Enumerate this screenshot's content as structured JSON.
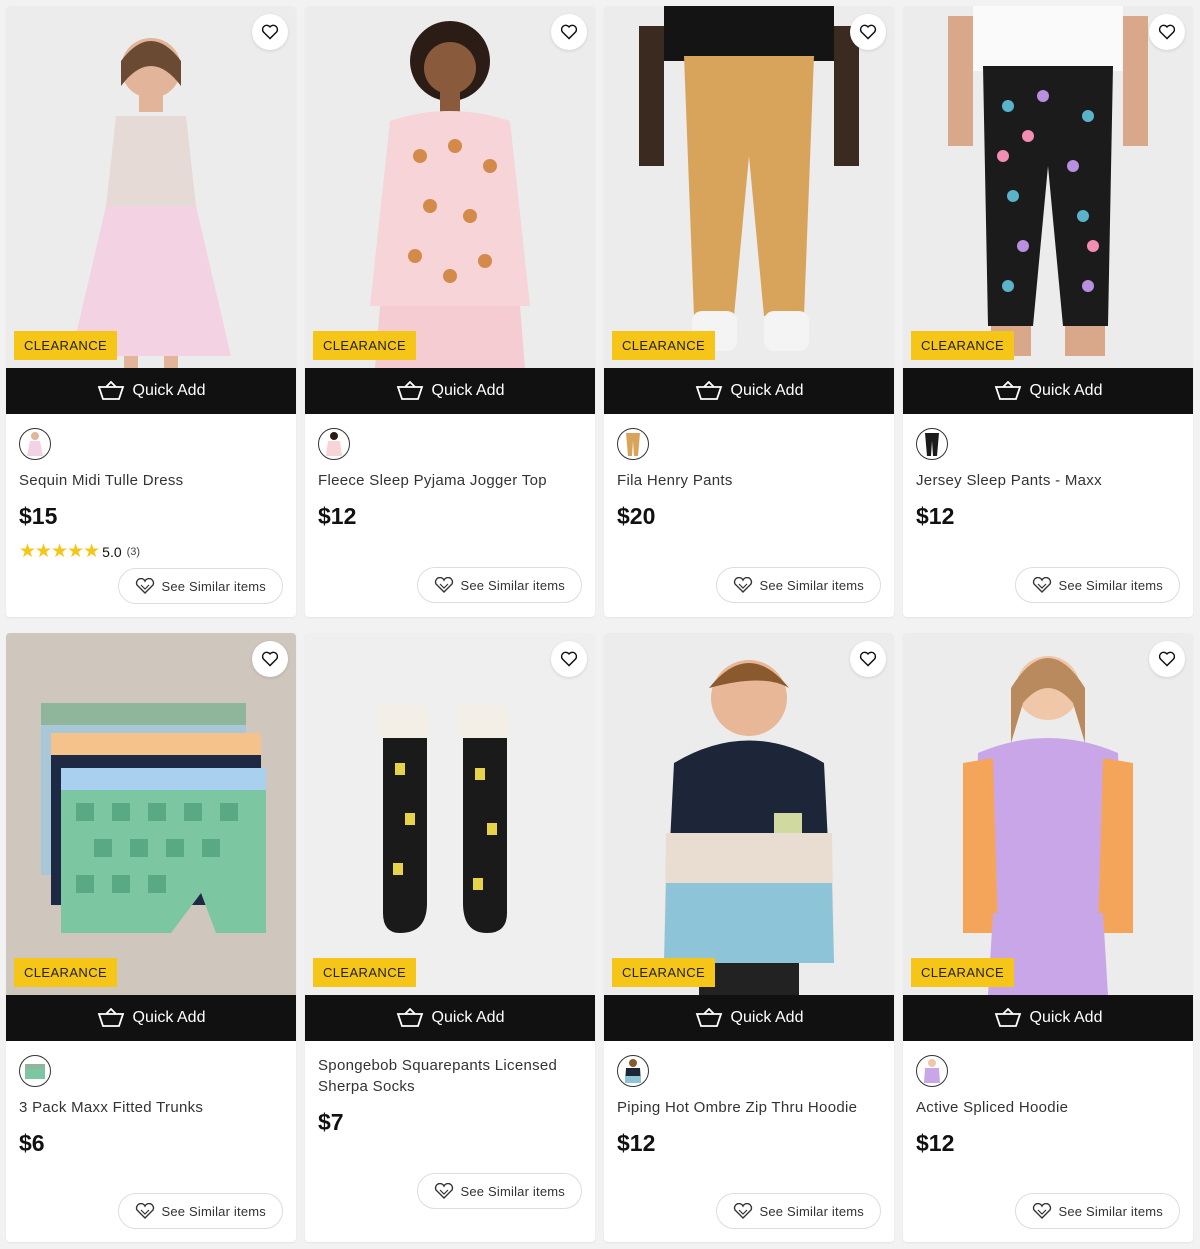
{
  "quick_add_label": "Quick Add",
  "badge_label": "CLEARANCE",
  "see_similar_label": "See Similar items",
  "products": [
    {
      "title": "Sequin Midi Tulle Dress",
      "price": "$15",
      "rating": "5.0",
      "rating_count": "(3)",
      "stars": "★★★★★",
      "badge": "CLEARANCE"
    },
    {
      "title": "Fleece Sleep Pyjama Jogger Top",
      "price": "$12",
      "badge": "CLEARANCE"
    },
    {
      "title": "Fila Henry Pants",
      "price": "$20",
      "badge": "CLEARANCE"
    },
    {
      "title": "Jersey Sleep Pants - Maxx",
      "price": "$12",
      "badge": "CLEARANCE"
    },
    {
      "title": "3 Pack Maxx Fitted Trunks",
      "price": "$6",
      "badge": "CLEARANCE"
    },
    {
      "title": "Spongebob Squarepants Licensed Sherpa Socks",
      "price": "$7"
    },
    {
      "title": "Piping Hot Ombre Zip Thru Hoodie",
      "price": "$12",
      "badge": "CLEARANCE"
    },
    {
      "title": "Active Spliced Hoodie",
      "price": "$12",
      "badge": "CLEARANCE"
    }
  ],
  "icons": {
    "wishlist": "heart-icon",
    "quick_add": "basket-icon",
    "similar": "similar-icon"
  },
  "colors": {
    "badge": "#f5c518",
    "quick_add_bg": "#111111",
    "star": "#f5c518"
  }
}
